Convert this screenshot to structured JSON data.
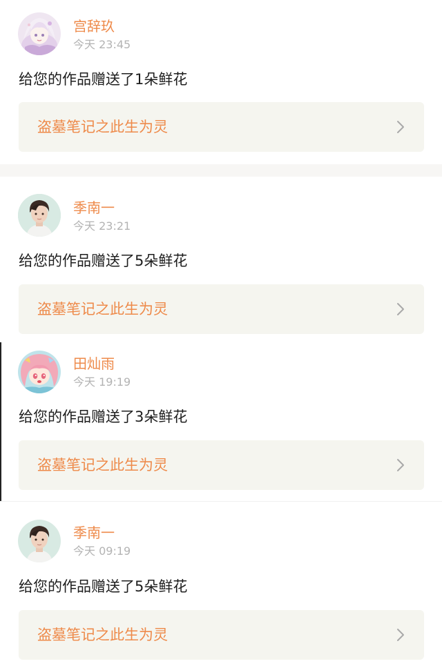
{
  "notifications": [
    {
      "user": "宫辞玖",
      "time": "今天 23:45",
      "message": "给您的作品赠送了1朵鲜花",
      "work_title": "盗墓笔记之此生为灵",
      "avatar_icon": "anime-girl-lilac-avatar"
    },
    {
      "user": "季南一",
      "time": "今天 23:21",
      "message": "给您的作品赠送了5朵鲜花",
      "work_title": "盗墓笔记之此生为灵",
      "avatar_icon": "young-man-portrait-avatar"
    },
    {
      "user": "田灿雨",
      "time": "今天 19:19",
      "message": "给您的作品赠送了3朵鲜花",
      "work_title": "盗墓笔记之此生为灵",
      "avatar_icon": "anime-pink-hair-avatar"
    },
    {
      "user": "季南一",
      "time": "今天 09:19",
      "message": "给您的作品赠送了5朵鲜花",
      "work_title": "盗墓笔记之此生为灵",
      "avatar_icon": "young-man-portrait-avatar"
    }
  ],
  "colors": {
    "accent": "#ee8a4a",
    "card_background": "#f5f5ef",
    "timestamp": "#b3b3b3",
    "message_text": "#1e1e1e",
    "section_gap": "#f7f6f4"
  }
}
